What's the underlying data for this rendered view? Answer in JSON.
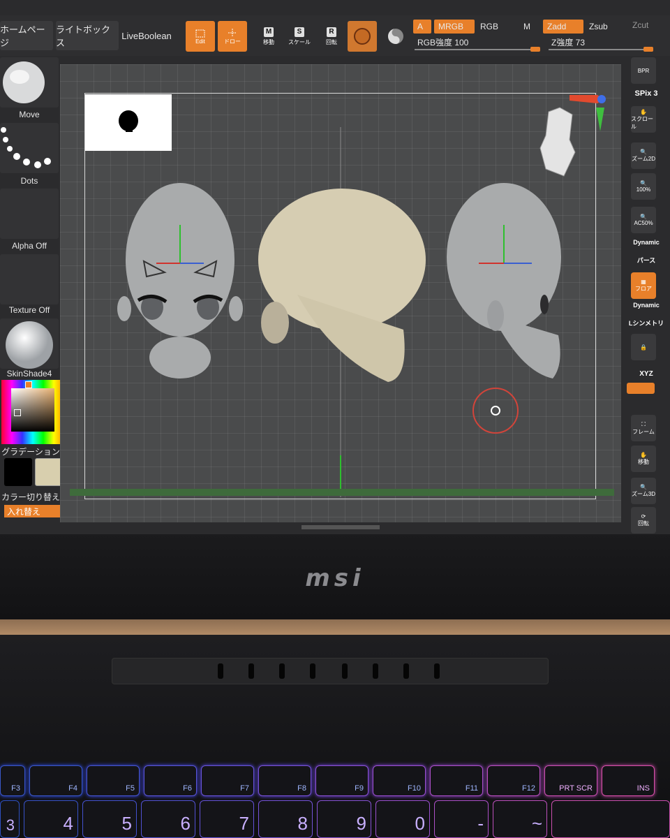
{
  "topbar": {
    "home": "ホームページ",
    "lightbox": "ライトボックス",
    "liveboolean": "LiveBoolean",
    "edit": "Edit",
    "draw": "ドロー",
    "move": {
      "key": "M",
      "label": "移動"
    },
    "scale": {
      "key": "S",
      "label": "スケール"
    },
    "rotate": {
      "key": "R",
      "label": "回転"
    },
    "a": "A",
    "mrgb": "MRGB",
    "rgb": "RGB",
    "m": "M",
    "zadd": "Zadd",
    "zsub": "Zsub",
    "zcut": "Zcut",
    "rgb_intensity": "RGB強度 100",
    "z_intensity": "Z強度 73"
  },
  "left_panel": {
    "brush": "Move",
    "stroke": "Dots",
    "alpha": "Alpha Off",
    "texture": "Texture Off",
    "material": "SkinShade4",
    "gradient": "グラデーション",
    "switch_color": "カラー切り替え",
    "swap": "入れ替え"
  },
  "right_panel": {
    "bpr": "BPR",
    "spix": "SPix 3",
    "scroll": "スクロール",
    "zoom2d": "ズーム2D",
    "p100": "100%",
    "ac50": "AC50%",
    "dynamic_label": "Dynamic",
    "perspective": "パース",
    "floor": "フロア",
    "dynamic2": "Dynamic",
    "lsym": "Lシンメトリ",
    "xyz": "XYZ",
    "frame": "フレーム",
    "move3d": "移動",
    "zoom3d": "ズーム3D",
    "rotate3d": "回転"
  },
  "laptop": {
    "logo": "msi",
    "fkeys": [
      "F3",
      "F4",
      "F5",
      "F6",
      "F7",
      "F8",
      "F9",
      "F10",
      "F11",
      "F12",
      "PRT SCR",
      "INS"
    ],
    "numkeys": [
      "3",
      "4",
      "5",
      "6",
      "7",
      "8",
      "9",
      "0",
      "-",
      "~",
      ""
    ]
  },
  "colors": {
    "accent": "#e8802a",
    "panel": "#2e2e30"
  }
}
